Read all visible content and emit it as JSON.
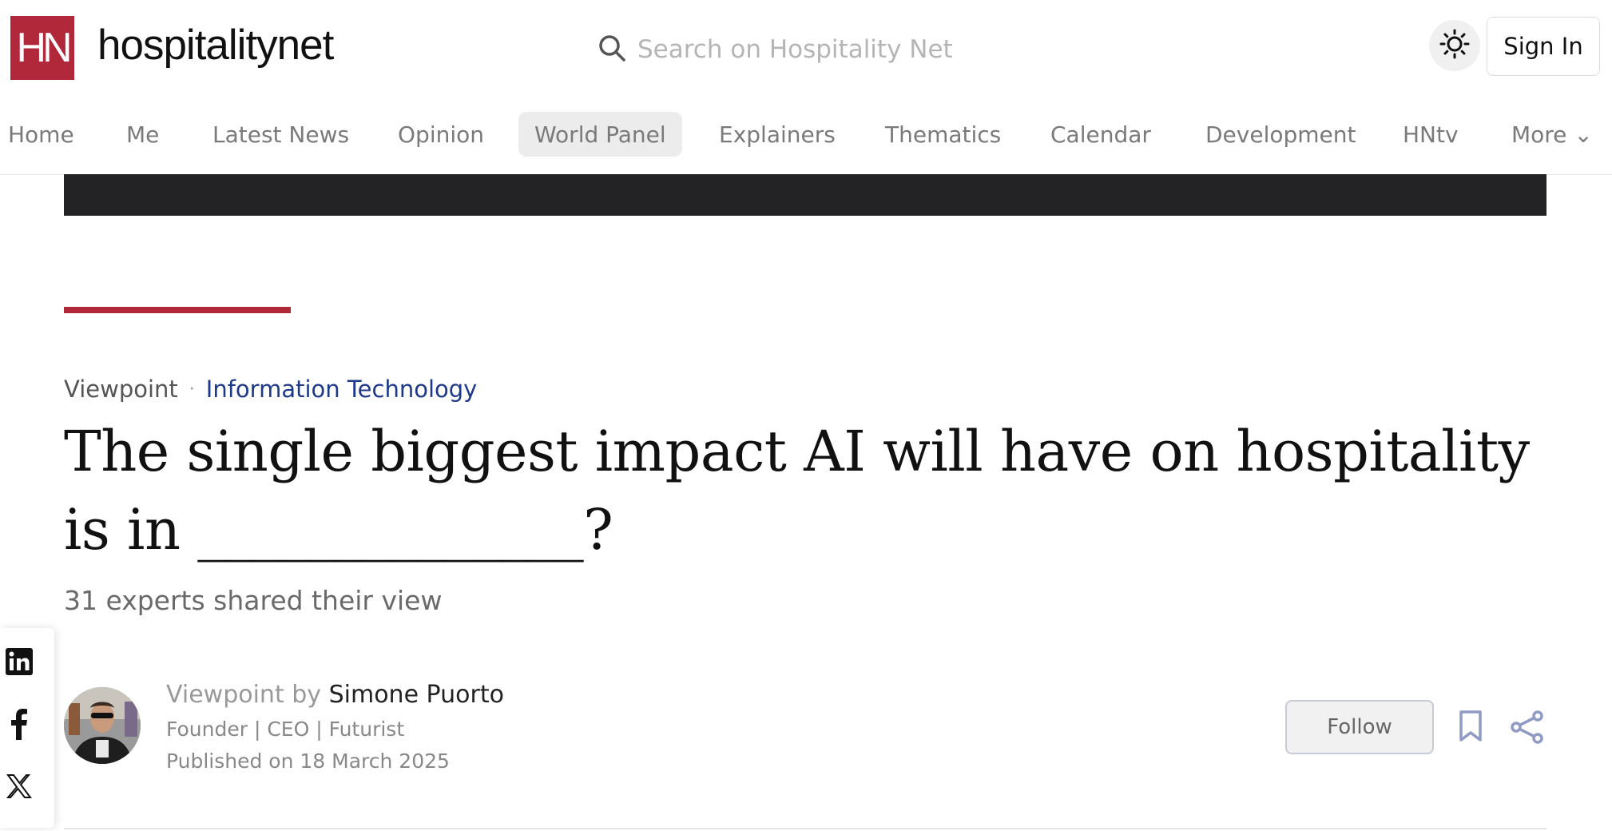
{
  "header": {
    "logo_text": "HN",
    "brand": "hospitalitynet",
    "search_placeholder": "Search on Hospitality Net",
    "signin_label": "Sign In",
    "theme_icon": "sun-icon"
  },
  "nav": {
    "items": [
      {
        "label": "Home"
      },
      {
        "label": "Me"
      },
      {
        "label": "Latest News"
      },
      {
        "label": "Opinion"
      },
      {
        "label": "World Panel",
        "active": true
      },
      {
        "label": "Explainers"
      },
      {
        "label": "Thematics"
      },
      {
        "label": "Calendar"
      },
      {
        "label": "Development"
      },
      {
        "label": "HNtv"
      },
      {
        "label": "More ⌄"
      }
    ]
  },
  "article": {
    "category": "Viewpoint",
    "separator": "·",
    "topic": "Information Technology",
    "title": "The single biggest impact AI will have on hospitality is in ______________?",
    "subtitle": "31 experts shared their view"
  },
  "author": {
    "prefix": "Viewpoint by",
    "name": "Simone Puorto",
    "role": "Founder | CEO | Futurist",
    "published": "Published on 18 March 2025",
    "follow_label": "Follow"
  },
  "social": [
    "linkedin-icon",
    "facebook-icon",
    "x-icon"
  ],
  "colors": {
    "brand_red": "#b0283a",
    "topic_blue": "#1d3a8a",
    "banner_dark": "#232325"
  }
}
